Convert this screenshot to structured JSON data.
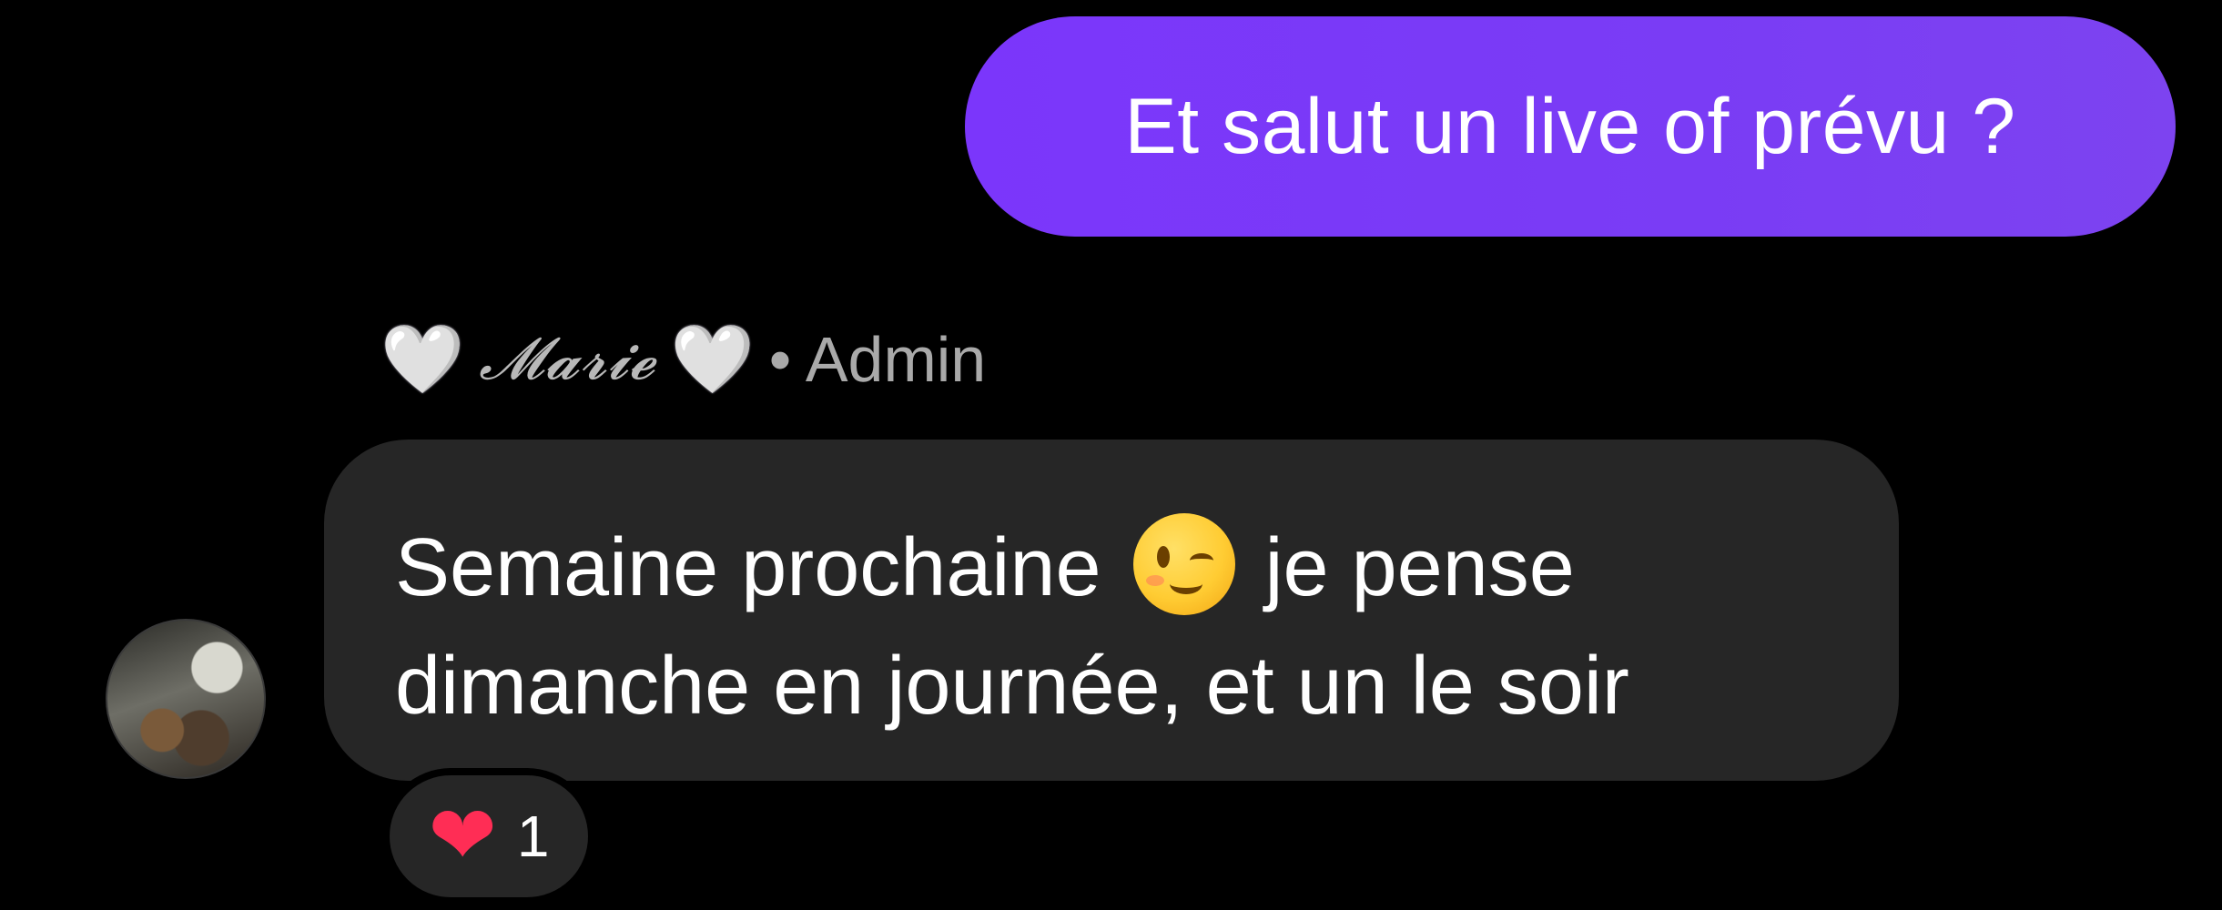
{
  "outgoing_message": {
    "text": "Et salut un live of prévu ?"
  },
  "incoming_message": {
    "sender_name": "𝓜𝓪𝓻𝓲𝓮",
    "sender_heart_left": "🤍",
    "sender_heart_right": "🤍",
    "sender_role": "• Admin",
    "line1_before_emoji": "Semaine prochaine",
    "emoji_name": "winking-face",
    "line1_after_emoji": "je pense",
    "line2": "dimanche en journée, et un le soir"
  },
  "reaction": {
    "icon": "red-heart",
    "glyph": "❤",
    "count": "1"
  },
  "colors": {
    "background": "#000000",
    "outgoing_bubble": "#7b3af8",
    "incoming_bubble": "#262626",
    "secondary_text": "#a9a9a9",
    "reaction_heart": "#ff2d55"
  }
}
